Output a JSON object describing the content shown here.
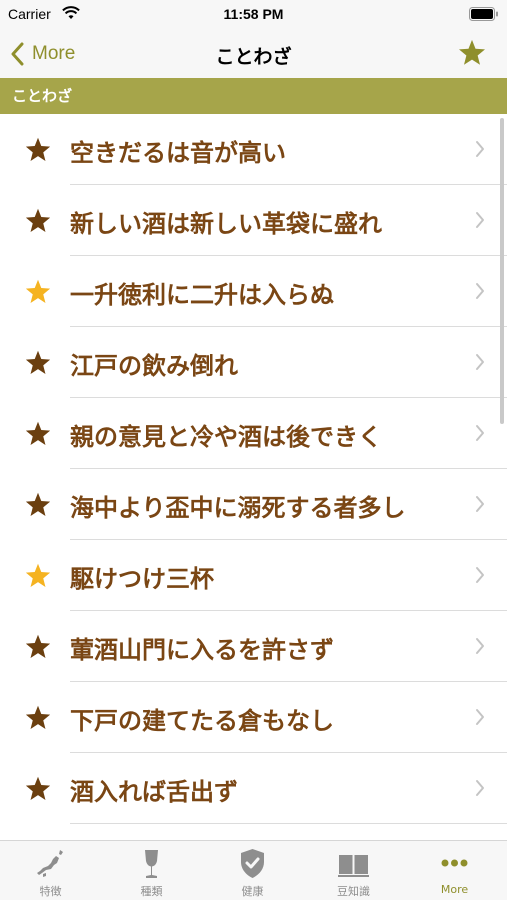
{
  "status_bar": {
    "carrier": "Carrier",
    "time": "11:58 PM"
  },
  "nav": {
    "back_label": "More",
    "title": "ことわざ",
    "favorite_icon": "star-icon"
  },
  "section": {
    "title": "ことわざ"
  },
  "colors": {
    "accent": "#8f8f2c",
    "section_bg": "#a6a54a",
    "item_text": "#7a4614",
    "star_dark": "#6b3f0f",
    "star_gold": "#f5b321"
  },
  "items": [
    {
      "label": "空きだるは音が高い",
      "star": "dark"
    },
    {
      "label": "新しい酒は新しい革袋に盛れ",
      "star": "dark"
    },
    {
      "label": "一升徳利に二升は入らぬ",
      "star": "gold"
    },
    {
      "label": "江戸の飲み倒れ",
      "star": "dark"
    },
    {
      "label": "親の意見と冷や酒は後できく",
      "star": "dark"
    },
    {
      "label": "海中より盃中に溺死する者多し",
      "star": "dark"
    },
    {
      "label": "駆けつけ三杯",
      "star": "gold"
    },
    {
      "label": "葷酒山門に入るを許さず",
      "star": "dark"
    },
    {
      "label": "下戸の建てたる倉もなし",
      "star": "dark"
    },
    {
      "label": "酒入れば舌出ず",
      "star": "dark"
    }
  ],
  "tabs": [
    {
      "label": "特徴",
      "icon": "japan-map-icon"
    },
    {
      "label": "種類",
      "icon": "wine-glass-icon"
    },
    {
      "label": "健康",
      "icon": "shield-check-icon"
    },
    {
      "label": "豆知識",
      "icon": "book-icon"
    },
    {
      "label": "More",
      "icon": "more-dots-icon",
      "active": true
    }
  ]
}
